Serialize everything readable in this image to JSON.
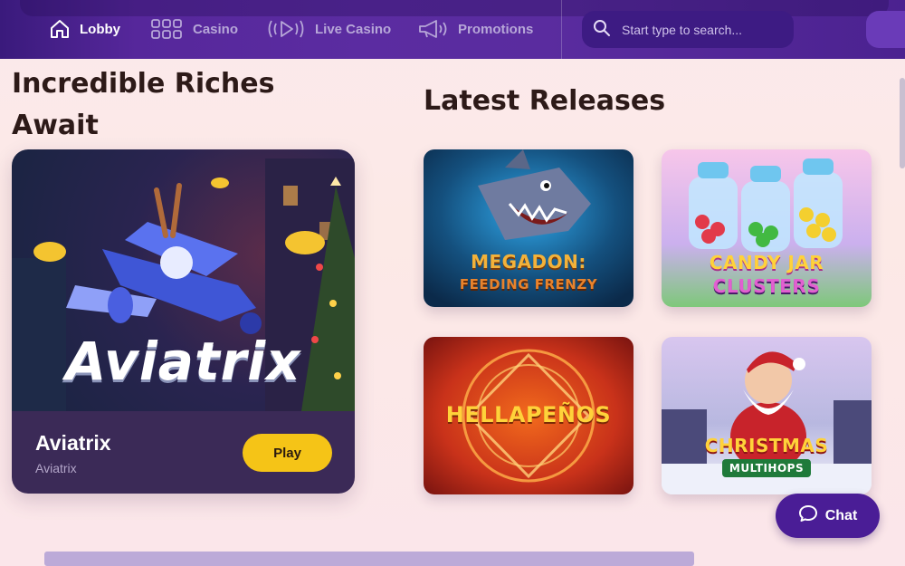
{
  "nav": {
    "items": [
      {
        "label": "Lobby",
        "icon": "home-icon",
        "active": true
      },
      {
        "label": "Casino",
        "icon": "grid-icon",
        "active": false
      },
      {
        "label": "Live Casino",
        "icon": "live-play-icon",
        "active": false
      },
      {
        "label": "Promotions",
        "icon": "megaphone-icon",
        "active": false
      }
    ],
    "search_placeholder": "Start type to search..."
  },
  "featured": {
    "heading": "Incredible Riches Await",
    "game": {
      "name": "Aviatrix",
      "provider": "Aviatrix",
      "art_logo": "Aviatrix",
      "play_label": "Play"
    }
  },
  "latest": {
    "heading": "Latest Releases",
    "games": [
      {
        "title_line1": "MEGADON:",
        "title_line2": "FEEDING FRENZY"
      },
      {
        "title_line1": "CANDY JAR",
        "title_line2": "CLUSTERS"
      },
      {
        "title_line1": "HELLAPEÑOS",
        "title_line2": ""
      },
      {
        "title_line1": "CHRISTMAS",
        "title_line2": "MULTIHOPS"
      }
    ]
  },
  "chat": {
    "label": "Chat"
  },
  "colors": {
    "accent": "#f5c417",
    "nav_bg": "#56279b",
    "chat_bg": "#4a1d96"
  }
}
